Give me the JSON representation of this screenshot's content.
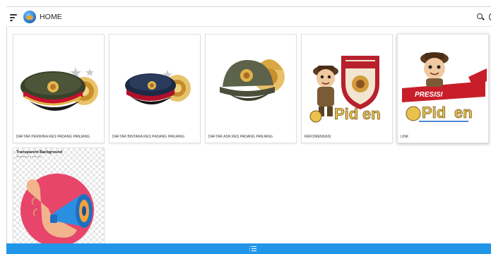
{
  "header": {
    "title": "HOME",
    "menu_icon": "menu-icon",
    "search_icon": "search-icon"
  },
  "cards": [
    {
      "label": "DAFTAR PERWIRA RES PADANG PANJANG",
      "image": "officer-peaked-cap"
    },
    {
      "label": "DAFTAR BINTARA RES PADANG PANJANG",
      "image": "navy-police-cap"
    },
    {
      "label": "DAFTAR ASN RES PADANG PANJANG",
      "image": "green-civil-servant-cap"
    },
    {
      "label": "REKOMENDASI",
      "image": "sdm-polri-mascot"
    },
    {
      "label": "LINK",
      "image": "presisi-mascot"
    }
  ],
  "sticker": {
    "title": "Transparent Background",
    "subtitle": "3D illustration & vector files"
  },
  "bottom_bar": {
    "icon": "list-icon"
  },
  "colors": {
    "accent": "#2196e8",
    "cap_red_band": "#c8102e",
    "gold": "#d8a43a",
    "sticker_pink": "#e8456a"
  }
}
